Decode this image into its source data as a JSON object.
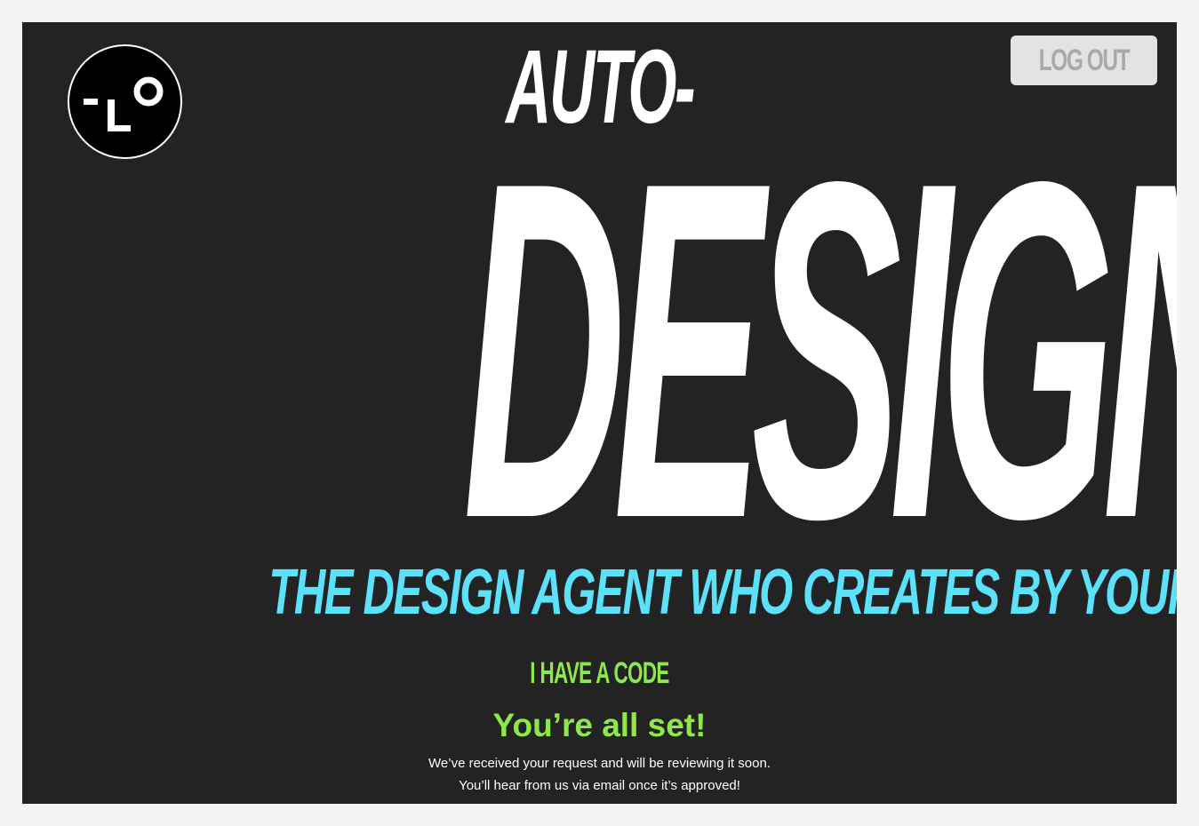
{
  "header": {
    "logout_label": "LOG OUT"
  },
  "hero": {
    "title_top": "AUTO-",
    "title_main": "DESIGN",
    "tagline": "THE DESIGN AGENT WHO CREATES BY YOUR SIDE."
  },
  "access": {
    "code_link": "I HAVE A CODE",
    "status_title": "You’re all set!",
    "status_line_1": "We’ve received your request and will be reviewing it soon.",
    "status_line_2": "You’ll hear from us via email once it’s approved!"
  },
  "colors": {
    "background": "#232323",
    "tagline": "#5ce1fa",
    "accent_green": "#8fe84b",
    "logout_bg": "#e3e3e3"
  },
  "icons": {
    "logo": "lo-logo-icon"
  }
}
